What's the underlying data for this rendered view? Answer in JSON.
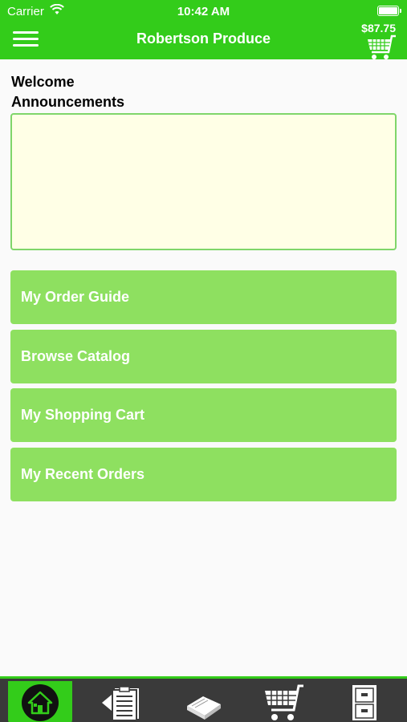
{
  "status_bar": {
    "carrier": "Carrier",
    "time": "10:42 AM"
  },
  "nav": {
    "title": "Robertson Produce",
    "cart_total": "$87.75",
    "menu_icon": "hamburger-icon",
    "cart_icon": "cart-icon"
  },
  "welcome": {
    "line1": "Welcome",
    "line2": "Announcements"
  },
  "menu": [
    {
      "label": "My Order Guide"
    },
    {
      "label": "Browse Catalog"
    },
    {
      "label": "My Shopping Cart"
    },
    {
      "label": "My Recent Orders"
    }
  ],
  "tabs": [
    {
      "icon": "home-icon",
      "active": true
    },
    {
      "icon": "order-guide-icon"
    },
    {
      "icon": "catalog-book-icon"
    },
    {
      "icon": "cart-icon"
    },
    {
      "icon": "file-cabinet-icon"
    }
  ],
  "colors": {
    "primary": "#33cc1a",
    "button": "#8ee060",
    "announce_bg": "#ffffe6",
    "tabbar": "#3a3a3a"
  }
}
